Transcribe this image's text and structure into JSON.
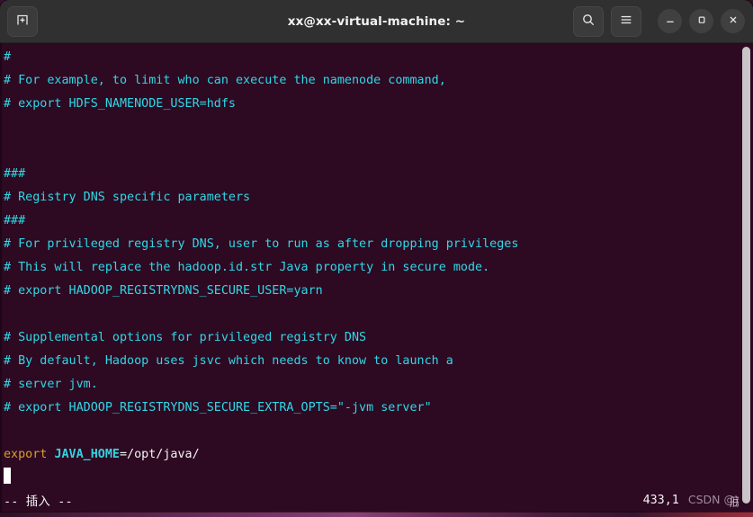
{
  "window": {
    "title": "xx@xx-virtual-machine: ~",
    "new_tab_icon": "new-tab-icon",
    "search_icon": "search-icon",
    "menu_icon": "hamburger-menu-icon",
    "minimize_icon": "minimize-icon",
    "maximize_icon": "maximize-icon",
    "close_icon": "close-icon"
  },
  "colors": {
    "titlebar_bg": "#303030",
    "terminal_bg": "#2d0922",
    "comment": "#2fd8e6",
    "keyword": "#d6a02a",
    "variable": "#33d2e0",
    "plain_text": "#f4f4f4",
    "cursor": "#ffffff",
    "scrollbar": "#c8c4c8"
  },
  "terminal": {
    "lines": [
      {
        "segments": [
          {
            "text": "#",
            "style": "comment"
          }
        ]
      },
      {
        "segments": [
          {
            "text": "# For example, to limit who can execute the namenode command,",
            "style": "comment"
          }
        ]
      },
      {
        "segments": [
          {
            "text": "# export HDFS_NAMENODE_USER=hdfs",
            "style": "comment"
          }
        ]
      },
      {
        "segments": []
      },
      {
        "segments": []
      },
      {
        "segments": [
          {
            "text": "###",
            "style": "comment"
          }
        ]
      },
      {
        "segments": [
          {
            "text": "# Registry DNS specific parameters",
            "style": "comment"
          }
        ]
      },
      {
        "segments": [
          {
            "text": "###",
            "style": "comment"
          }
        ]
      },
      {
        "segments": [
          {
            "text": "# For privileged registry DNS, user to run as after dropping privileges",
            "style": "comment"
          }
        ]
      },
      {
        "segments": [
          {
            "text": "# This will replace the hadoop.id.str Java property in secure mode.",
            "style": "comment"
          }
        ]
      },
      {
        "segments": [
          {
            "text": "# export HADOOP_REGISTRYDNS_SECURE_USER=yarn",
            "style": "comment"
          }
        ]
      },
      {
        "segments": []
      },
      {
        "segments": [
          {
            "text": "# Supplemental options for privileged registry DNS",
            "style": "comment"
          }
        ]
      },
      {
        "segments": [
          {
            "text": "# By default, Hadoop uses jsvc which needs to know to launch a",
            "style": "comment"
          }
        ]
      },
      {
        "segments": [
          {
            "text": "# server jvm.",
            "style": "comment"
          }
        ]
      },
      {
        "segments": [
          {
            "text": "# export HADOOP_REGISTRYDNS_SECURE_EXTRA_OPTS=\"-jvm server\"",
            "style": "comment"
          }
        ]
      },
      {
        "segments": []
      },
      {
        "segments": [
          {
            "text": "export ",
            "style": "kw"
          },
          {
            "text": "JAVA_HOME",
            "style": "var"
          },
          {
            "text": "=/opt/java/",
            "style": "plain"
          }
        ]
      },
      {
        "segments": [],
        "cursor": true
      }
    ]
  },
  "statusline": {
    "mode": "-- 插入 --",
    "position": "433,1",
    "watermark": "CSDN @",
    "watermark_cjk": "底端",
    "watermark_cjk_overlap": "底端"
  },
  "scrollbar": {
    "name": "vertical-scrollbar"
  }
}
